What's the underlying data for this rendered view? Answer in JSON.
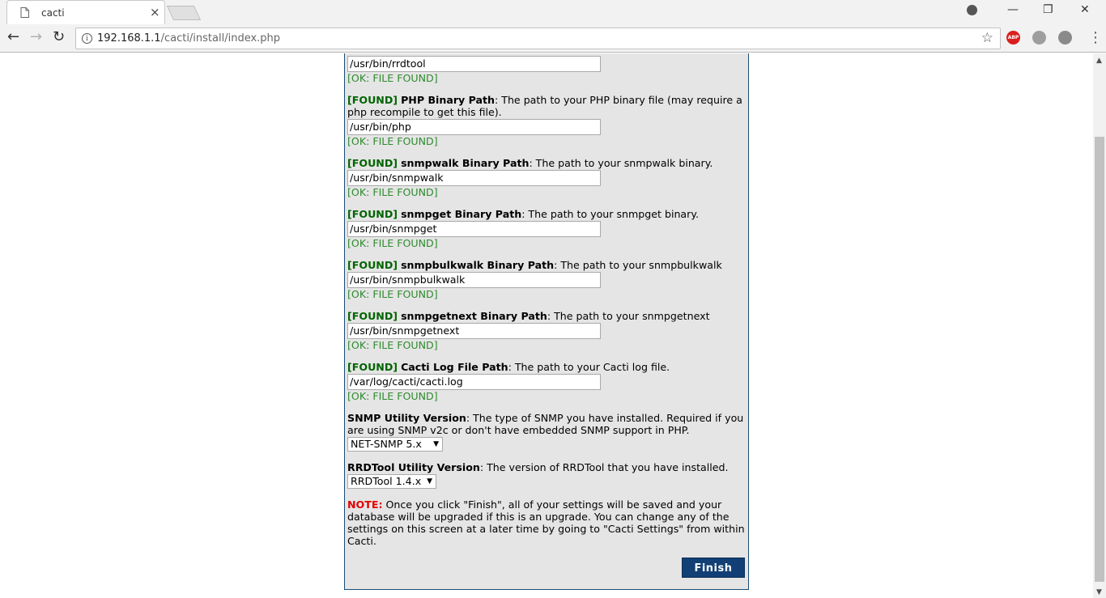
{
  "browser": {
    "tab_title": "cacti",
    "tab_close": "×",
    "url_host": "192.168.1.1",
    "url_path": "/cacti/install/index.php",
    "window_controls": [
      "—",
      "❐",
      "✕"
    ],
    "nav": {
      "back": "←",
      "forward": "→",
      "reload": "↻"
    },
    "extensions": {
      "abp": "ABP"
    }
  },
  "install": {
    "found_tag": "[FOUND]",
    "ok_text": "[OK: FILE FOUND]",
    "rrdtool_value": "/usr/bin/rrdtool",
    "fields": [
      {
        "title": "PHP Binary Path",
        "description": ": The path to your PHP binary file (may require a php recompile to get this file).",
        "value": "/usr/bin/php"
      },
      {
        "title": "snmpwalk Binary Path",
        "description": ": The path to your snmpwalk binary.",
        "value": "/usr/bin/snmpwalk"
      },
      {
        "title": "snmpget Binary Path",
        "description": ": The path to your snmpget binary.",
        "value": "/usr/bin/snmpget"
      },
      {
        "title": "snmpbulkwalk Binary Path",
        "description": ": The path to your snmpbulkwalk binary.",
        "value": "/usr/bin/snmpbulkwalk"
      },
      {
        "title": "snmpgetnext Binary Path",
        "description": ": The path to your snmpgetnext binary.",
        "value": "/usr/bin/snmpgetnext"
      },
      {
        "title": "Cacti Log File Path",
        "description": ": The path to your Cacti log file.",
        "value": "/var/log/cacti/cacti.log"
      }
    ],
    "snmp_version": {
      "title": "SNMP Utility Version",
      "description": ": The type of SNMP you have installed. Required if you are using SNMP v2c or don't have embedded SNMP support in PHP.",
      "selected": "NET-SNMP 5.x"
    },
    "rrdtool_version": {
      "title": "RRDTool Utility Version",
      "description": ": The version of RRDTool that you have installed.",
      "selected": "RRDTool 1.4.x"
    },
    "note": {
      "label": "NOTE:",
      "text": " Once you click \"Finish\", all of your settings will be saved and your database will be upgraded if this is an upgrade. You can change any of the settings on this screen at a later time by going to \"Cacti Settings\" from within Cacti."
    },
    "finish_label": "Finish"
  }
}
